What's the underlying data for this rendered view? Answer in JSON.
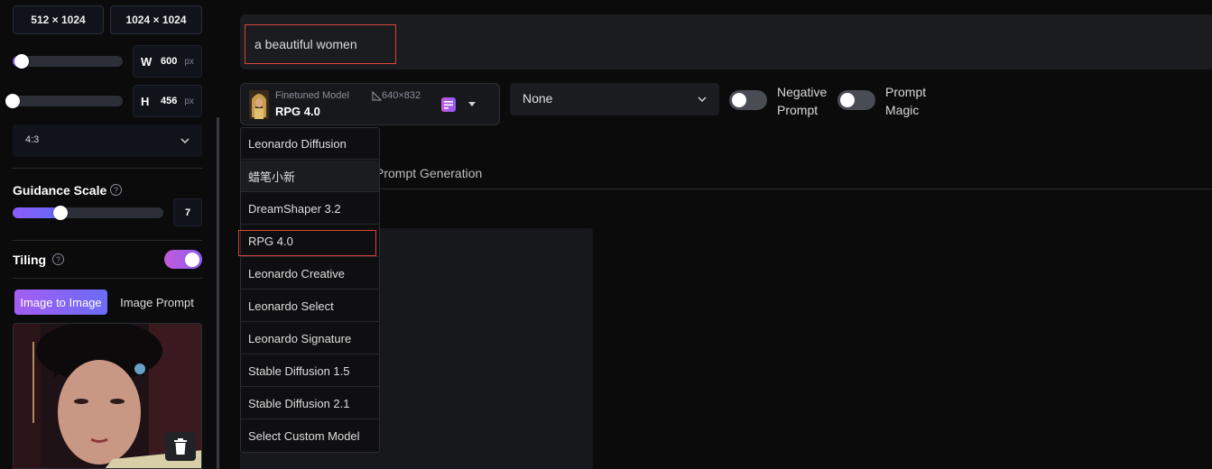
{
  "sidebar": {
    "dim_buttons": [
      "512 × 1024",
      "1024 × 1024"
    ],
    "width": {
      "label": "W",
      "value": "600",
      "unit": "px",
      "slider_fraction": 0.08
    },
    "height": {
      "label": "H",
      "value": "456",
      "unit": "px",
      "slider_fraction": 0.0
    },
    "aspect_ratio": "4:3",
    "guidance": {
      "label": "Guidance Scale",
      "value": "7",
      "slider_fraction": 0.32
    },
    "tiling": {
      "label": "Tiling",
      "enabled": true
    },
    "image_tabs": {
      "active": "Image to Image",
      "inactive": "Image Prompt"
    }
  },
  "prompt": {
    "value": "a beautiful women"
  },
  "model": {
    "type_label": "Finetuned Model",
    "name": "RPG 4.0",
    "resolution": "640×832"
  },
  "style_select": {
    "value": "None"
  },
  "toggles": {
    "negative_prompt": {
      "line1": "Negative",
      "line2": "Prompt",
      "enabled": false
    },
    "prompt_magic": {
      "line1": "Prompt",
      "line2": "Magic",
      "enabled": false
    }
  },
  "tab_prompt_generation": "Prompt Generation",
  "dropdown": {
    "items": [
      "Leonardo Diffusion",
      "蜡笔小新",
      "DreamShaper 3.2",
      "RPG 4.0",
      "Leonardo Creative",
      "Leonardo Select",
      "Leonardo Signature",
      "Stable Diffusion 1.5",
      "Stable Diffusion 2.1",
      "Select Custom Model"
    ],
    "hovered_index": 1,
    "selected_index": 3
  },
  "colors": {
    "accent_start": "#8e5cf6",
    "accent_end": "#5d6bf7",
    "highlight": "#d8443c"
  }
}
